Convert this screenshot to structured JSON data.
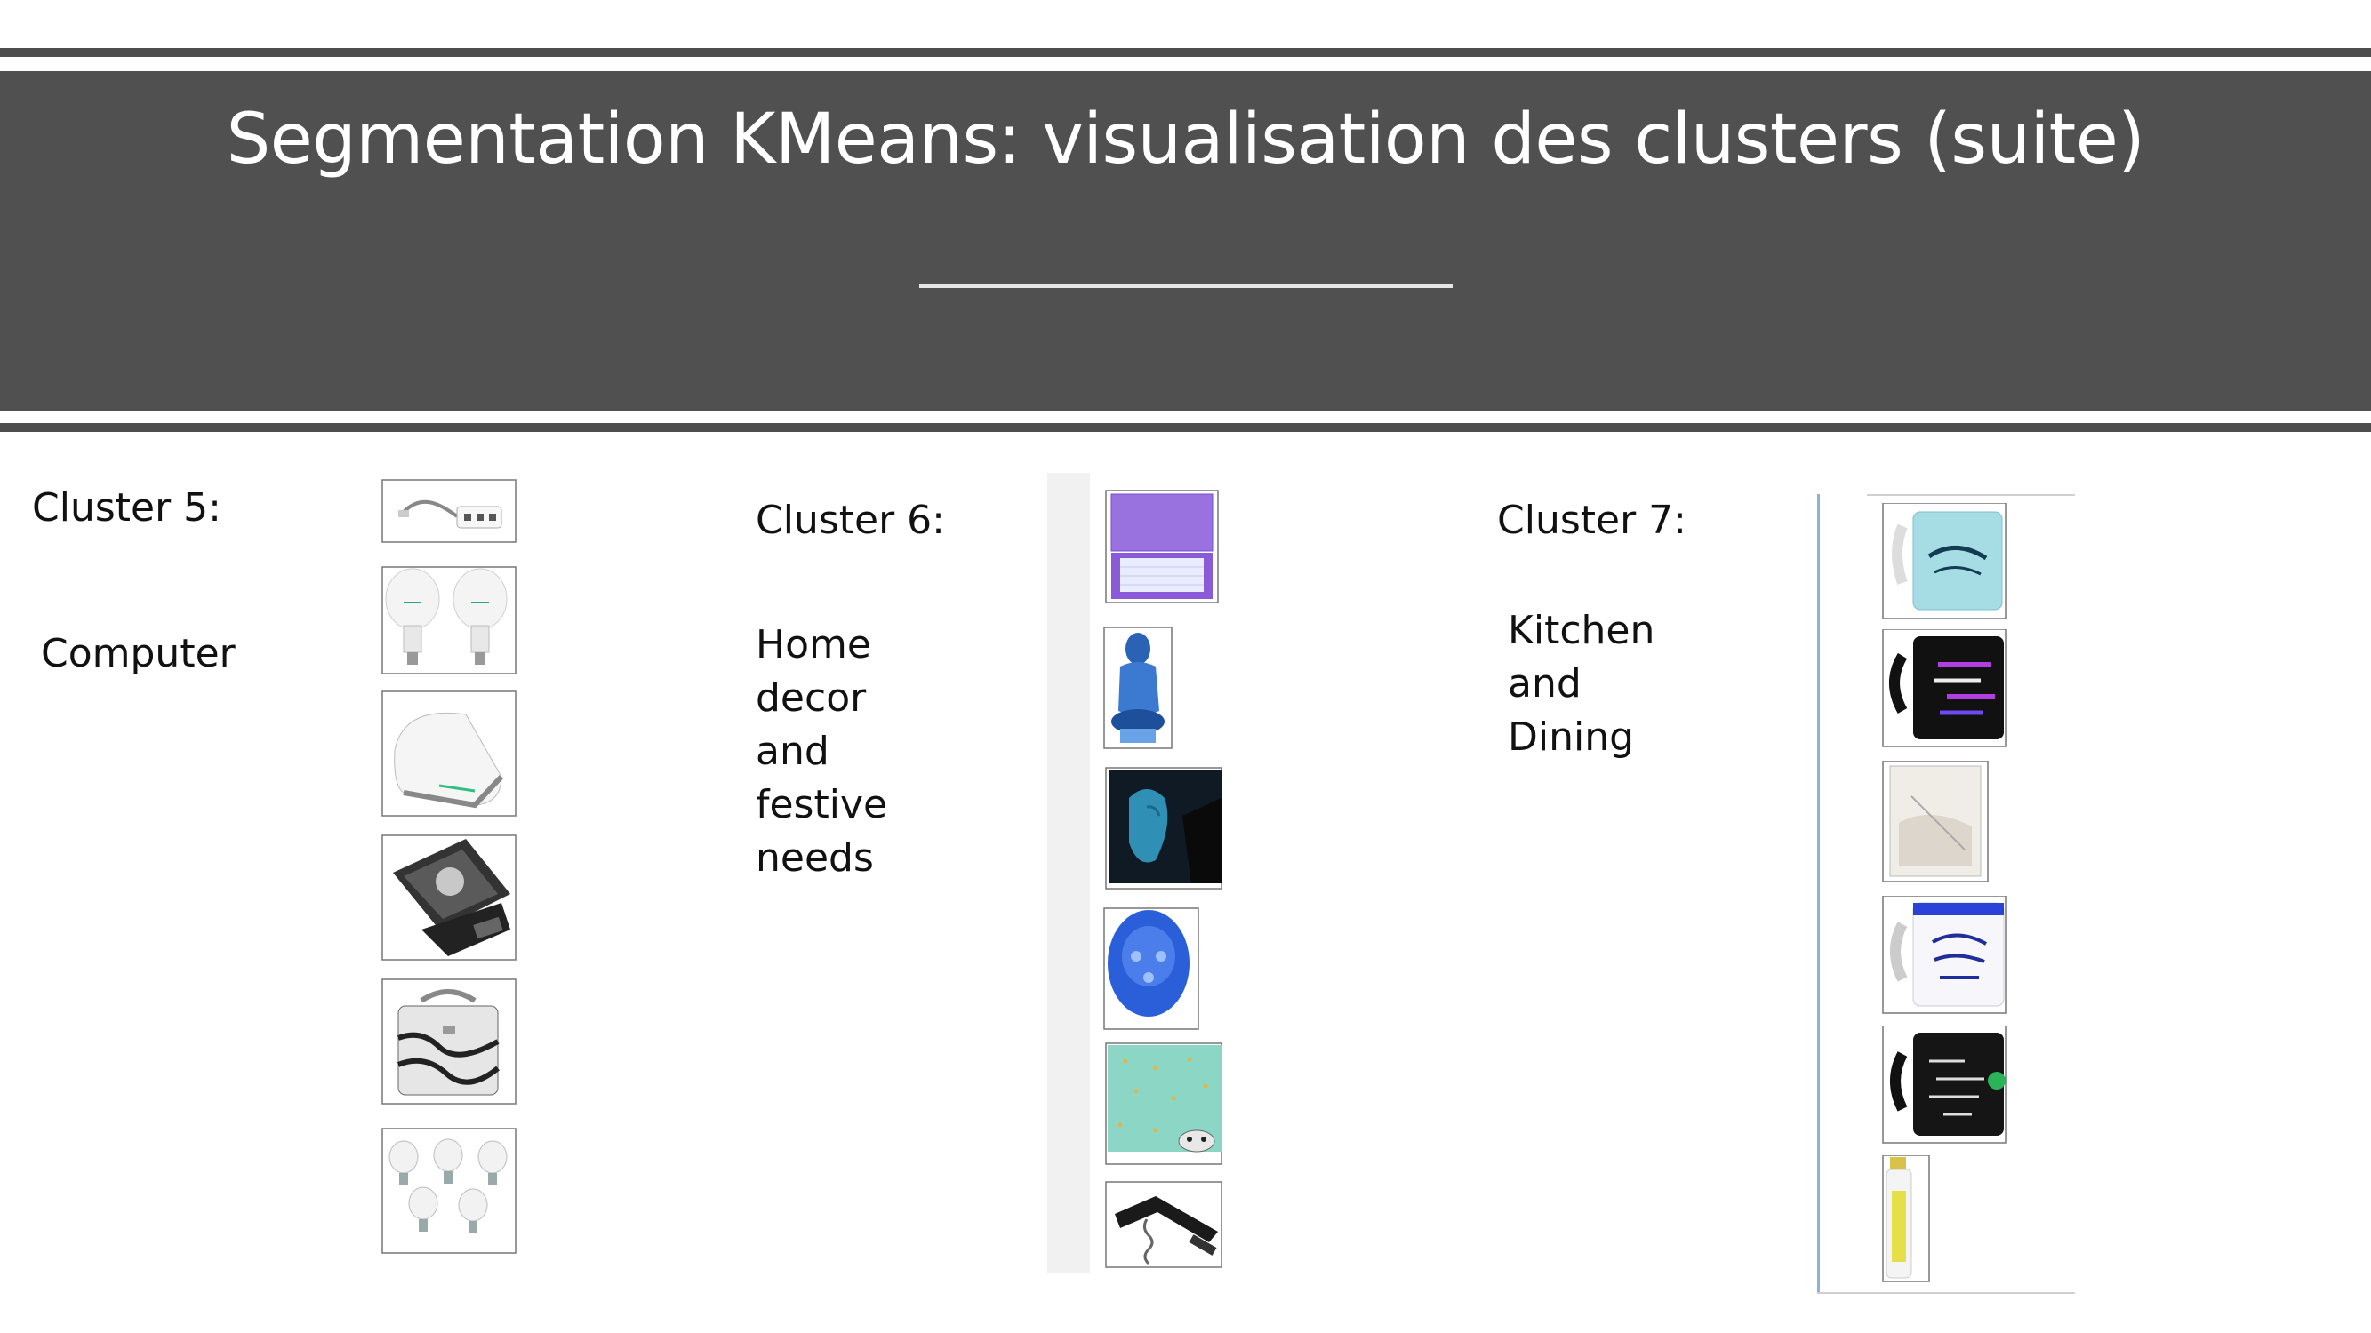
{
  "slide": {
    "title": "Segmentation KMeans: visualisation des clusters (suite)"
  },
  "clusters": [
    {
      "label": "Cluster 5:",
      "category": "Computer",
      "thumbnails": [
        "usb-hub-icon",
        "led-bulbs-icon",
        "wifi-router-icon",
        "laptop-skin-icon",
        "vanity-case-icon",
        "bulb-pack-icon"
      ]
    },
    {
      "label": "Cluster 6:",
      "category_lines": [
        "Home",
        "decor",
        "and",
        "festive",
        "needs"
      ],
      "thumbnails": [
        "tablet-keyboard-case-icon",
        "blue-statue-icon",
        "buddha-tile-icon",
        "blue-bowl-icon",
        "teal-pattern-icon",
        "corkscrew-icon"
      ]
    },
    {
      "label": "Cluster 7:",
      "category_lines": [
        "Kitchen",
        "and",
        "Dining"
      ],
      "thumbnails": [
        "believe-mug-icon",
        "black-mug-icon",
        "glass-tumbler-icon",
        "birthday-mug-icon",
        "black-quote-mug-icon",
        "infuser-bottle-icon"
      ]
    }
  ],
  "colors": {
    "banner": "#505050",
    "rule": "#4d4d4d",
    "accent_blue": "#2b5fd9",
    "purple": "#8a5ad8"
  }
}
